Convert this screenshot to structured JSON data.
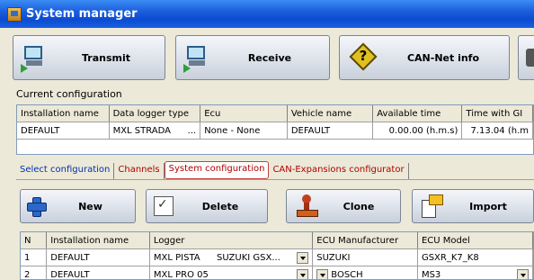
{
  "window": {
    "title": "System manager"
  },
  "toolbar": {
    "transmit": "Transmit",
    "receive": "Receive",
    "can_net_info": "CAN-Net info"
  },
  "current_config": {
    "label": "Current configuration",
    "headers": [
      "Installation name",
      "Data logger type",
      "Ecu",
      "Vehicle name",
      "Available time",
      "Time with GI"
    ],
    "row": {
      "installation": "DEFAULT",
      "logger": "MXL STRADA",
      "logger_ellipsis": "...",
      "ecu": "None - None",
      "vehicle": "DEFAULT",
      "available_time": "0.00.00 (h.m.s)",
      "time_with_gps": "7.13.04 (h.m"
    }
  },
  "tabs": [
    {
      "label": "Select configuration"
    },
    {
      "label": "Channels"
    },
    {
      "label": "System configuration"
    },
    {
      "label": "CAN-Expansions configurator"
    }
  ],
  "actions": {
    "new": "New",
    "delete": "Delete",
    "clone": "Clone",
    "import": "Import"
  },
  "config_table": {
    "headers": [
      "N",
      "Installation name",
      "Logger",
      "ECU Manufacturer",
      "ECU Model"
    ],
    "rows": [
      {
        "n": "1",
        "name": "DEFAULT",
        "logger": "MXL PISTA",
        "logger_extra": "SUZUKI GSX...",
        "manufacturer": "SUZUKI",
        "model": "GSXR_K7_K8"
      },
      {
        "n": "2",
        "name": "DEFAULT",
        "logger": "MXL PRO 05",
        "logger_extra": "",
        "manufacturer": "BOSCH",
        "model": "MS3"
      }
    ]
  }
}
